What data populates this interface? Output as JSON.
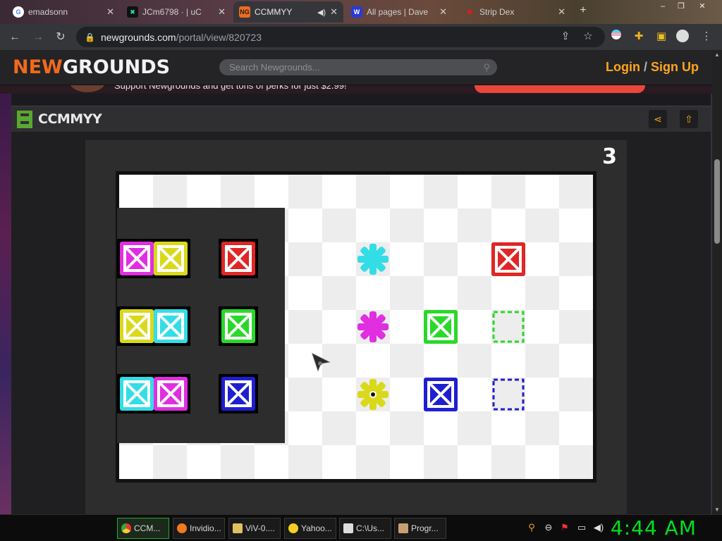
{
  "browser": {
    "tabs": [
      {
        "label": "emadsonn",
        "favicon": "google-icon",
        "active": false
      },
      {
        "label": "JCm6798 · | uC",
        "favicon": "mixer-icon",
        "active": false
      },
      {
        "label": "CCMMYY",
        "favicon": "newgrounds-icon",
        "active": true
      },
      {
        "label": "All pages | Dave",
        "favicon": "wiki-icon",
        "active": false
      },
      {
        "label": "Strip Dex",
        "favicon": "heart-icon",
        "active": false
      }
    ],
    "url_host": "newgrounds.com",
    "url_path": "/portal/view/820723"
  },
  "site": {
    "logo_new": "NEW",
    "logo_grounds": "GROUNDS",
    "search_placeholder": "Search Newgrounds...",
    "login": "Login",
    "signup": "Sign Up",
    "promo_text": "Support Newgrounds and get tons of perks for just $2.99!"
  },
  "portal": {
    "title": "CCMMYY"
  },
  "game": {
    "level": "3",
    "colors": {
      "magenta": "#e02ee0",
      "yellow": "#d9d91a",
      "cyan": "#33dde6",
      "red": "#e02626",
      "green": "#29d929",
      "blue": "#1f1fd0"
    }
  },
  "taskbar": {
    "items": [
      {
        "label": "CCM...",
        "icon": "chrome-icon",
        "color": "#e8b21c",
        "active": true
      },
      {
        "label": "Invidio...",
        "icon": "firefox-icon",
        "color": "#f07a1e",
        "active": false
      },
      {
        "label": "ViV-0....",
        "icon": "document-icon",
        "color": "#e0c060",
        "active": false
      },
      {
        "label": "Yahoo...",
        "icon": "emoji-icon",
        "color": "#f5d020",
        "active": false
      },
      {
        "label": "C:\\Us...",
        "icon": "archive-icon",
        "color": "#dddddd",
        "active": false
      },
      {
        "label": "Progr...",
        "icon": "program-icon",
        "color": "#c8a070",
        "active": false
      }
    ],
    "clock": "4:44 AM"
  }
}
